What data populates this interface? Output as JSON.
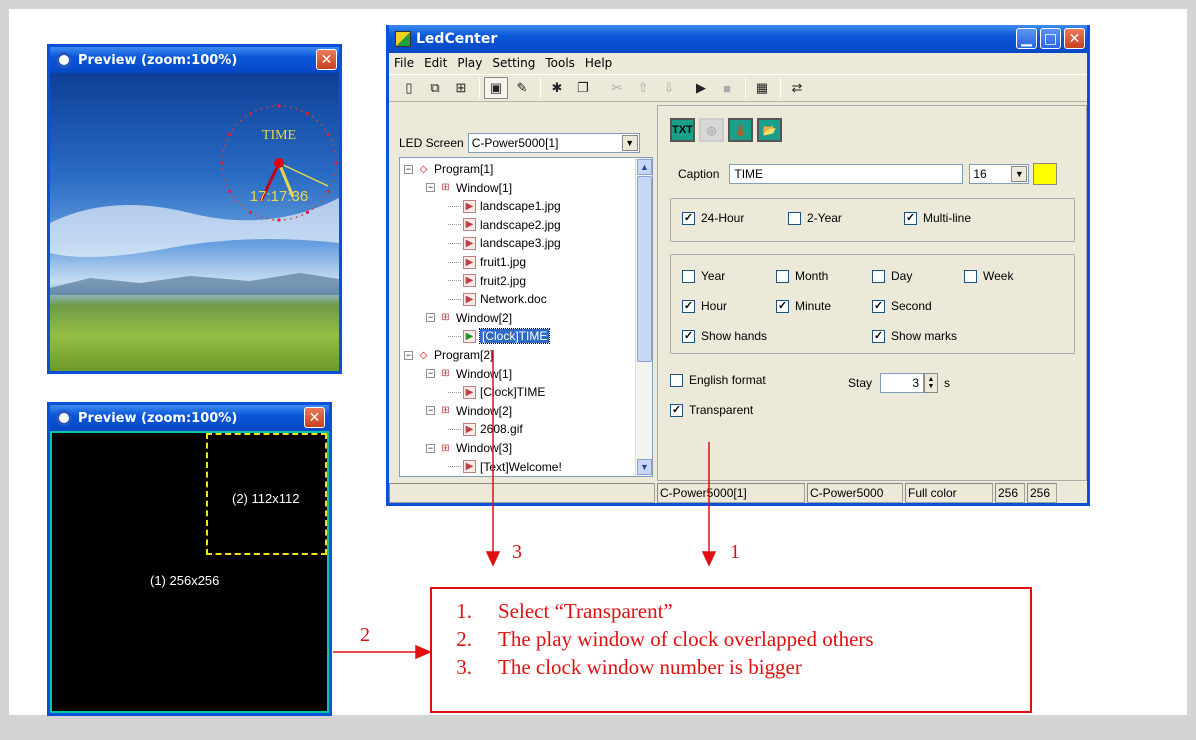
{
  "preview1": {
    "title": "Preview (zoom:100%)",
    "clock_caption": "TIME",
    "clock_time": "17:17:36"
  },
  "preview2": {
    "title": "Preview (zoom:100%)",
    "window1_label": "(1) 256x256",
    "window2_label": "(2) 112x112"
  },
  "app": {
    "title": "LedCenter",
    "menu": [
      "File",
      "Edit",
      "Play",
      "Setting",
      "Tools",
      "Help"
    ],
    "led_screen_label": "LED Screen",
    "led_screen_value": "C-Power5000[1]",
    "tree": [
      {
        "text": "Program[1]",
        "kind": "prog"
      },
      {
        "text": "Window[1]",
        "kind": "win"
      },
      {
        "text": "landscape1.jpg",
        "kind": "file"
      },
      {
        "text": "landscape2.jpg",
        "kind": "file"
      },
      {
        "text": "landscape3.jpg",
        "kind": "file"
      },
      {
        "text": "fruit1.jpg",
        "kind": "file"
      },
      {
        "text": "fruit2.jpg",
        "kind": "file"
      },
      {
        "text": "Network.doc",
        "kind": "file"
      },
      {
        "text": "Window[2]",
        "kind": "win"
      },
      {
        "text": "[Clock]TIME",
        "kind": "file-selected"
      },
      {
        "text": "Program[2]",
        "kind": "prog"
      },
      {
        "text": "Window[1]",
        "kind": "win"
      },
      {
        "text": "[Clock]TIME",
        "kind": "file"
      },
      {
        "text": "Window[2]",
        "kind": "win"
      },
      {
        "text": "2608.gif",
        "kind": "file"
      },
      {
        "text": "Window[3]",
        "kind": "win"
      },
      {
        "text": "[Text]Welcome!",
        "kind": "file"
      }
    ],
    "tabs": [
      "TXT",
      "CLK",
      "TMP",
      "OPN"
    ],
    "caption_label": "Caption",
    "caption_value": "TIME",
    "font_size": "16",
    "caption_color": "#ffff00",
    "options1": [
      {
        "label": "24-Hour",
        "checked": true
      },
      {
        "label": "2-Year",
        "checked": false
      },
      {
        "label": "Multi-line",
        "checked": true
      }
    ],
    "options2": [
      {
        "label": "Year",
        "checked": false
      },
      {
        "label": "Month",
        "checked": false
      },
      {
        "label": "Day",
        "checked": false
      },
      {
        "label": "Week",
        "checked": false
      },
      {
        "label": "Hour",
        "checked": true
      },
      {
        "label": "Minute",
        "checked": true
      },
      {
        "label": "Second",
        "checked": true
      },
      {
        "label": "Show hands",
        "checked": true
      },
      {
        "label": "Show marks",
        "checked": true
      }
    ],
    "english_format": {
      "label": "English format",
      "checked": false
    },
    "stay_label": "Stay",
    "stay_value": "3",
    "stay_unit": "s",
    "transparent": {
      "label": "Transparent",
      "checked": true
    },
    "status": [
      "C-Power5000[1]",
      "C-Power5000",
      "Full color",
      "256",
      "256"
    ]
  },
  "annotations": {
    "marker1": "1",
    "marker2": "2",
    "marker3": "3",
    "notes": [
      {
        "n": "1.",
        "text": "Select “Transparent”"
      },
      {
        "n": "2.",
        "text": "The play window of clock overlapped others"
      },
      {
        "n": "3.",
        "text": "The clock window number is bigger"
      }
    ],
    "color": "#e01010"
  }
}
